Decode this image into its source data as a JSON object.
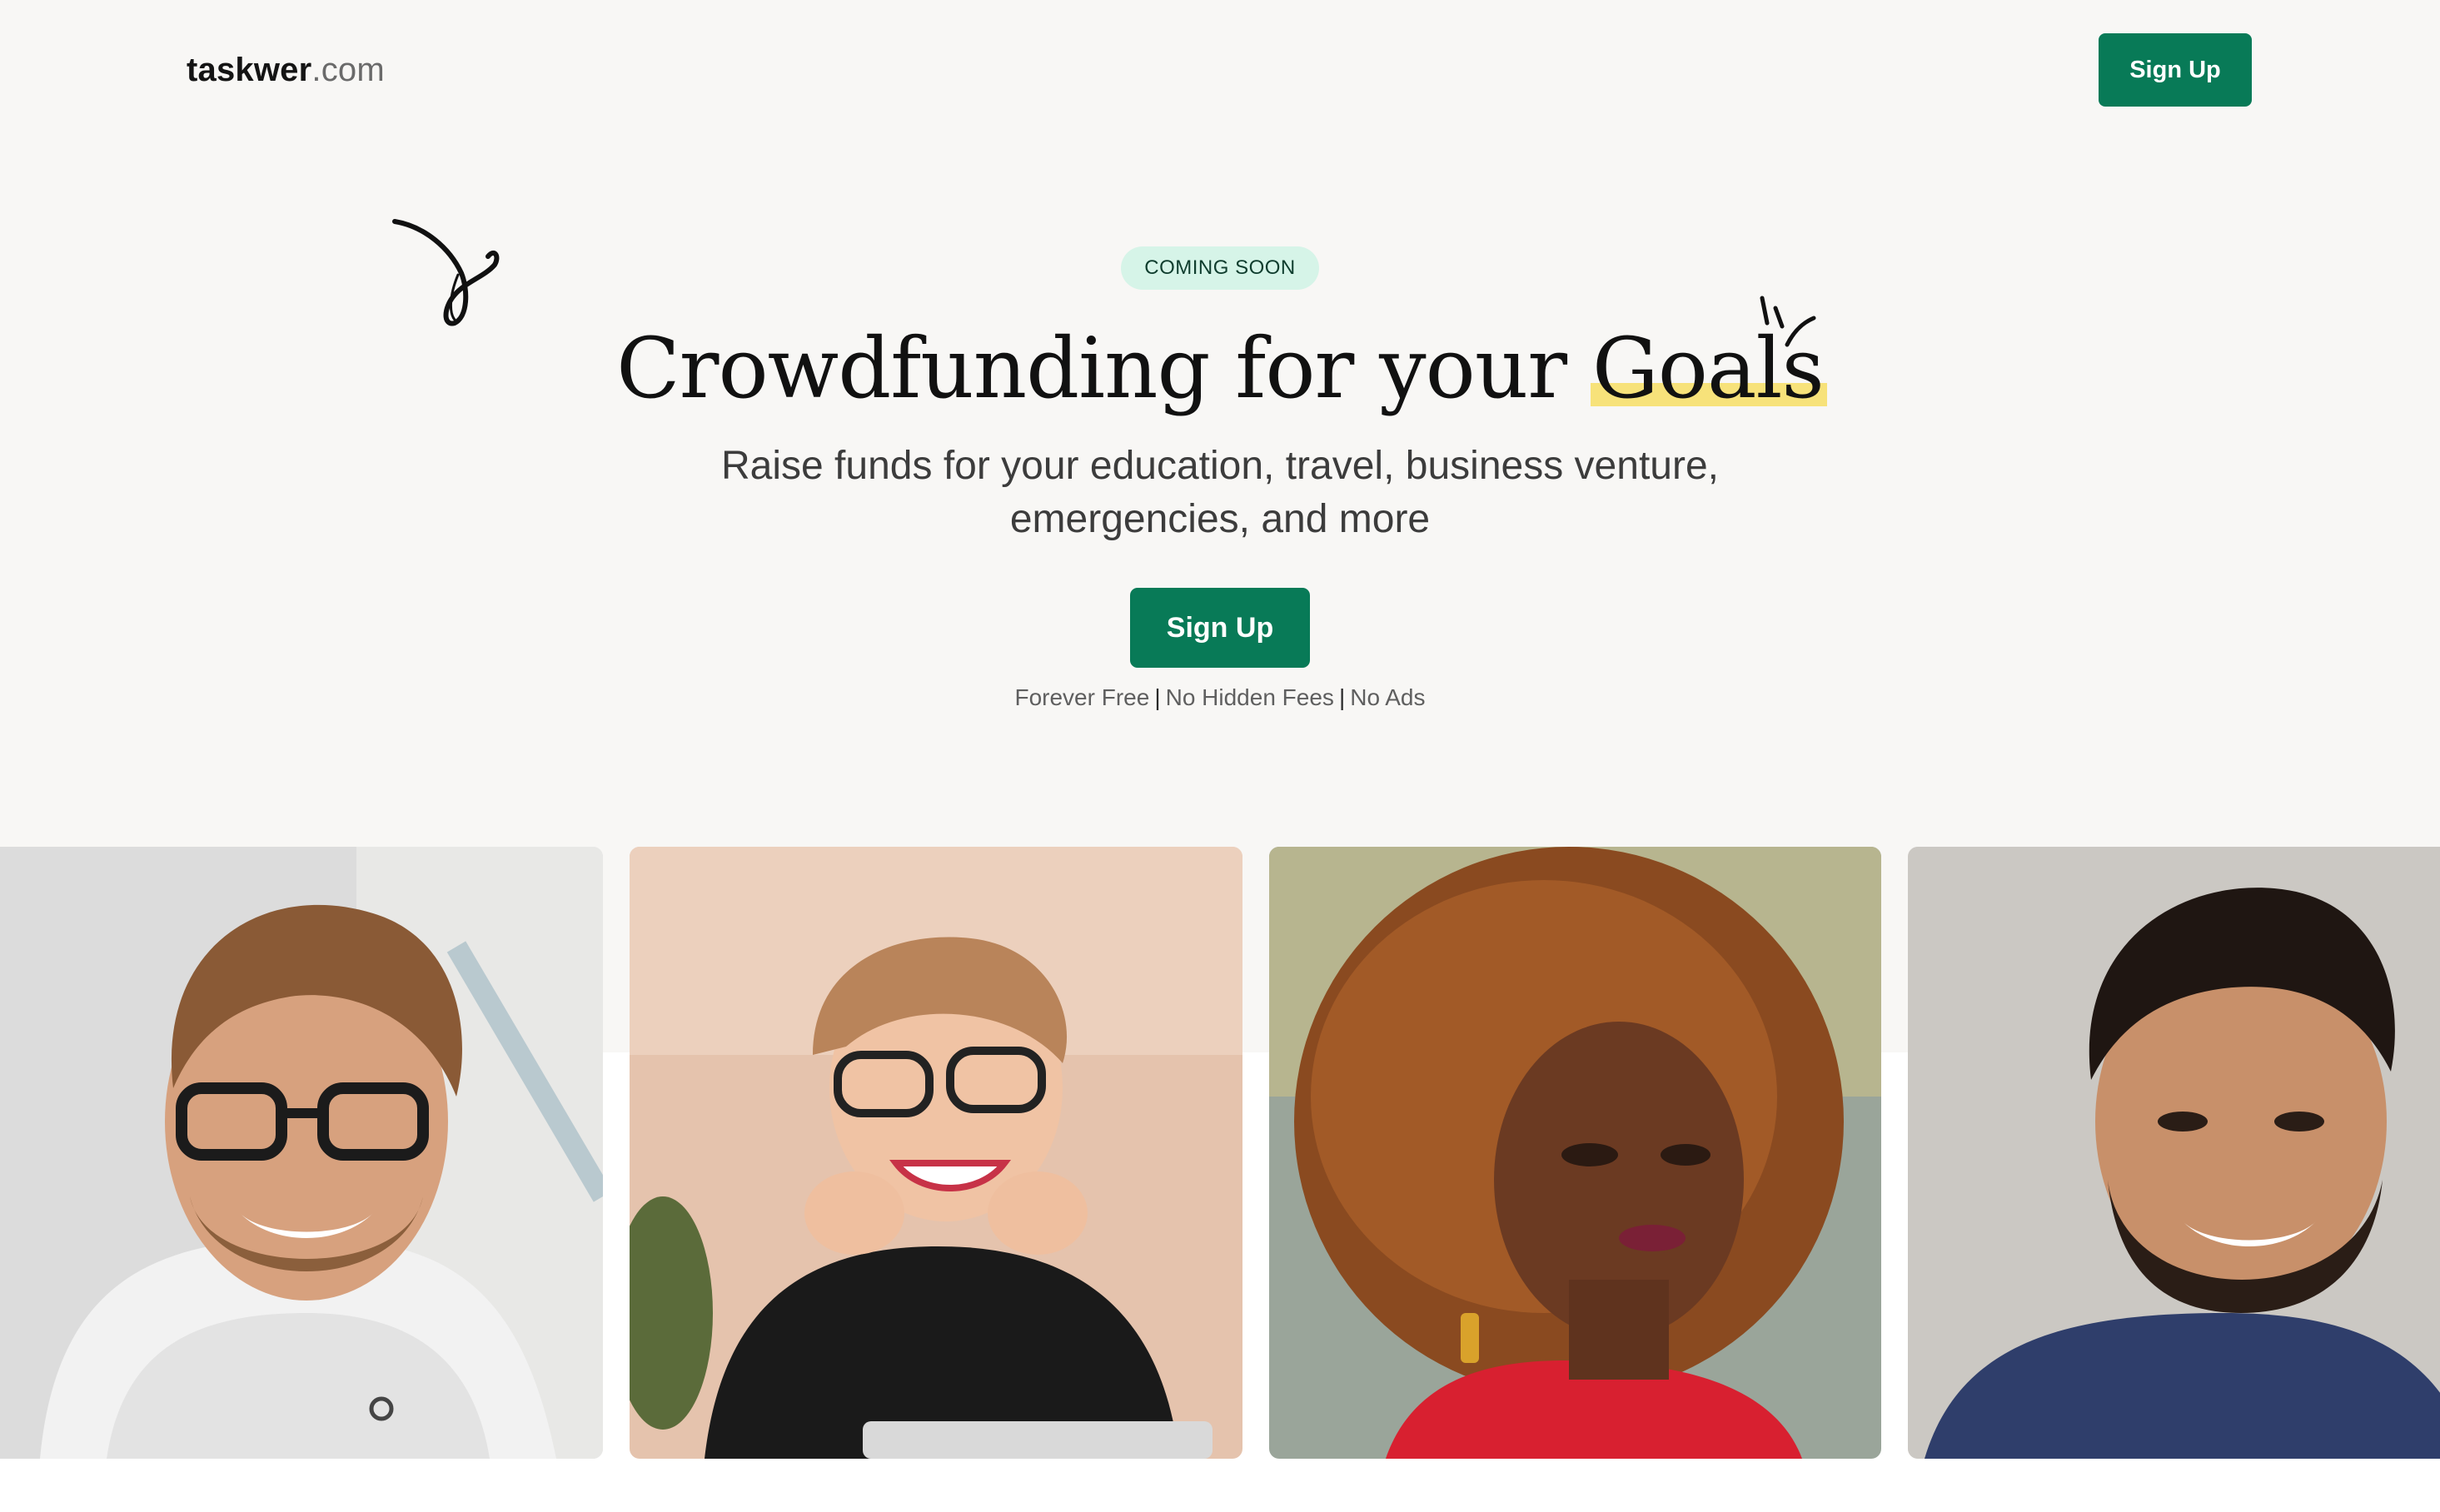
{
  "header": {
    "brand_name": "taskwer",
    "brand_tld": ".com",
    "signup_label": "Sign Up"
  },
  "hero": {
    "badge": "COMING SOON",
    "headline_prefix": "Crowdfunding for your ",
    "headline_highlight": "Goals",
    "subtitle_line1": "Raise funds for your education, travel, business venture,",
    "subtitle_line2": "emergencies, and more",
    "signup_label": "Sign Up",
    "features": [
      "Forever Free",
      "No Hidden Fees",
      "No Ads"
    ]
  },
  "colors": {
    "accent": "#087a57",
    "badge_bg": "#d6f4e8",
    "highlight": "#f7e27a",
    "hero_bg": "#f8f7f5"
  },
  "icons": {
    "decor_left": "squiggle-arrow-icon",
    "decor_right": "sparkle-lines-icon"
  },
  "photos": [
    {
      "name": "smiling-man-glasses-hoodie-photo"
    },
    {
      "name": "smiling-woman-glasses-photo"
    },
    {
      "name": "woman-curly-hair-photo"
    },
    {
      "name": "smiling-bearded-man-photo"
    }
  ]
}
